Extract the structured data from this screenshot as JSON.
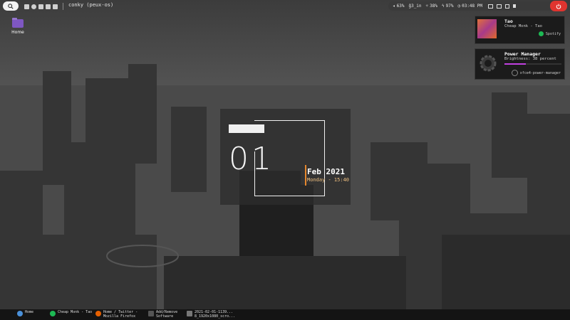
{
  "top_panel": {
    "search_icon": "magnifier-icon",
    "launchers": [
      "file-icon",
      "steam-icon",
      "folder-icon",
      "terminal-icon",
      "grid-icon"
    ],
    "window_title": "conky (peux-os)",
    "tray": {
      "volume": "63%",
      "network": "ĝ3_in",
      "brightness": "38%",
      "battery": "97%",
      "clock": "03:48 PM"
    }
  },
  "desktop": {
    "home_label": "Home"
  },
  "notifications": [
    {
      "title": "Tao",
      "body": "Cheap Monk - Tao",
      "app": "Spotify"
    },
    {
      "title": "Power Manager",
      "body": "Brightness: 38 percent",
      "app": "xfce4-power-manager",
      "level": 0.38
    }
  ],
  "clock_widget": {
    "day": "01",
    "date": "Feb 2021",
    "time": "Monday - 15:40"
  },
  "taskbar": [
    {
      "label1": "Home",
      "label2": ""
    },
    {
      "label1": "Cheap Monk - Tao",
      "label2": ""
    },
    {
      "label1": "Home / Twitter -",
      "label2": "Mozilla Firefox"
    },
    {
      "label1": "Add/Remove",
      "label2": "Software"
    },
    {
      "label1": "2021-02-01-1139...",
      "label2": "8_1920x1080_scro..."
    }
  ],
  "colors": {
    "accent": "#e5872d",
    "power": "#e0342f",
    "bar": "#c040e0"
  }
}
